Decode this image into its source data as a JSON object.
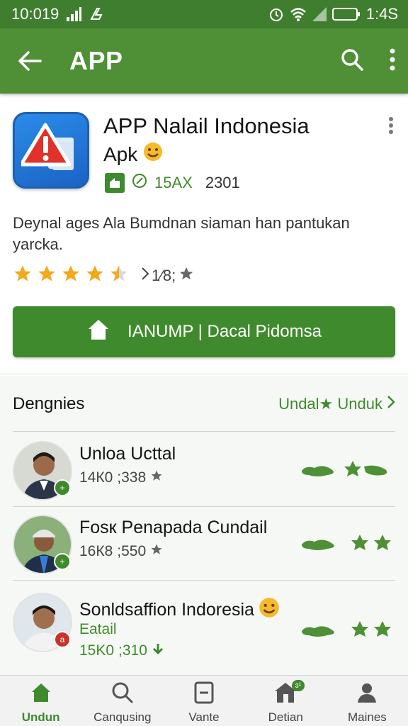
{
  "status_bar": {
    "time": "10:019",
    "time_right": "1:4S"
  },
  "app_bar": {
    "title": "APP"
  },
  "app": {
    "name": "APP Nalail Indonesia",
    "subtitle": "Apk",
    "meta_code": "15AX",
    "meta_number": "2301",
    "description": "Deynal ages Ala Bumdnan siaman han pantukan yarcka.",
    "rating_stars": 4.5,
    "rating_count": "1⁄8;",
    "install_label": "IANUMP | Dacal Pidomsa"
  },
  "section": {
    "title": "Dengnies",
    "link_label": "Undal★ Unduk"
  },
  "items": [
    {
      "title": "Unloa Ucttal",
      "stat_a": "14К0",
      "stat_b": ";338"
    },
    {
      "title": "Fosк Penapada Cundail",
      "stat_a": "16К8",
      "stat_b": ";550"
    },
    {
      "title": "Sonldsaffion Indoresia",
      "subline": "Eatail",
      "stat_a": "15K0",
      "stat_b": ";310"
    }
  ],
  "nav": [
    {
      "label": "Undun",
      "icon": "home-icon",
      "active": true
    },
    {
      "label": "Canqusing",
      "icon": "search-icon",
      "active": false
    },
    {
      "label": "Vante",
      "icon": "minus-box-icon",
      "active": false
    },
    {
      "label": "Detian",
      "icon": "store-icon",
      "badge": "ɜ¹",
      "active": false
    },
    {
      "label": "Maines",
      "icon": "person-icon",
      "active": false
    }
  ],
  "colors": {
    "primary": "#4f8f36",
    "primary_dark": "#3f7e2e",
    "accent": "#3f8a2d",
    "star": "#f4a81c"
  }
}
